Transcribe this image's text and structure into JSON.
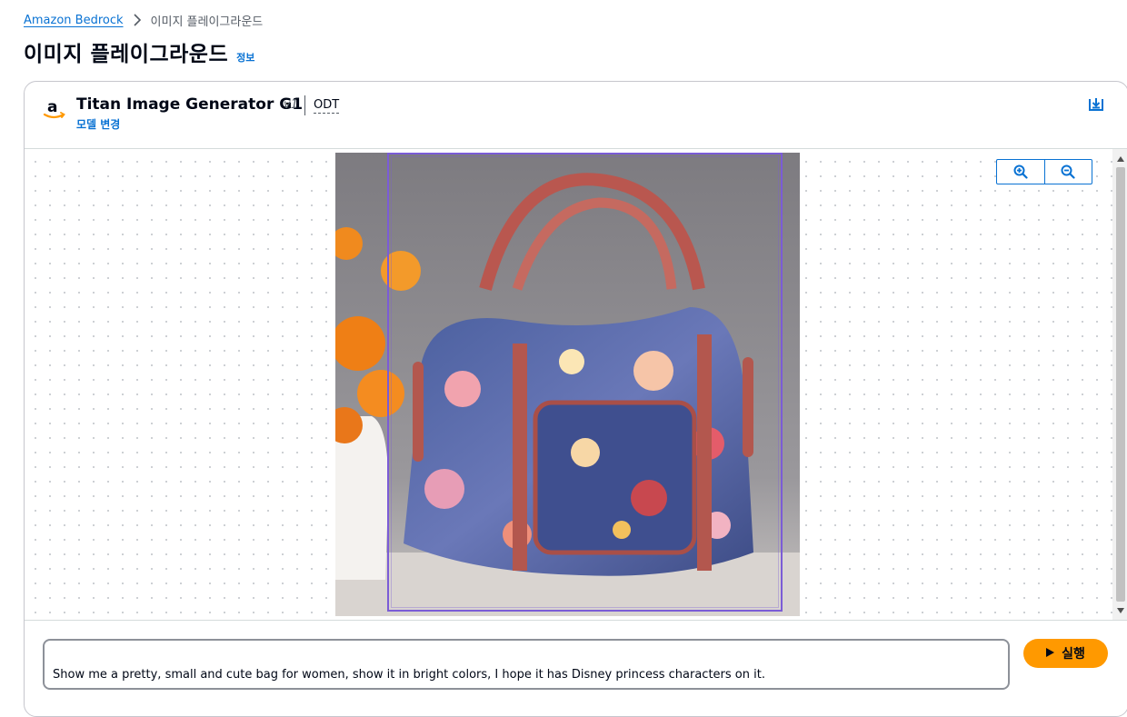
{
  "breadcrumb": {
    "root": "Amazon Bedrock",
    "current": "이미지 플레이그라운드"
  },
  "page": {
    "title": "이미지 플레이그라운드",
    "info_link": "정보"
  },
  "model": {
    "name": "Titan Image Generator G1",
    "version": "v1",
    "tag": "ODT",
    "change_link": "모델 변경",
    "logo_icon": "amazon-logo"
  },
  "canvas": {
    "zoom_in_icon": "zoom-in-icon",
    "zoom_out_icon": "zoom-out-icon",
    "image_subject": "floral handbag with red leather trim, orange flowers in a white vase"
  },
  "prompt": {
    "text": "Show me a pretty, small and cute bag for women, show it in bright colors, I hope it has Disney princess characters on it.",
    "run_label": "실행"
  },
  "colors": {
    "accent": "#0972d3",
    "run_button": "#ff9900",
    "mask_frame": "#7b5cd6"
  }
}
